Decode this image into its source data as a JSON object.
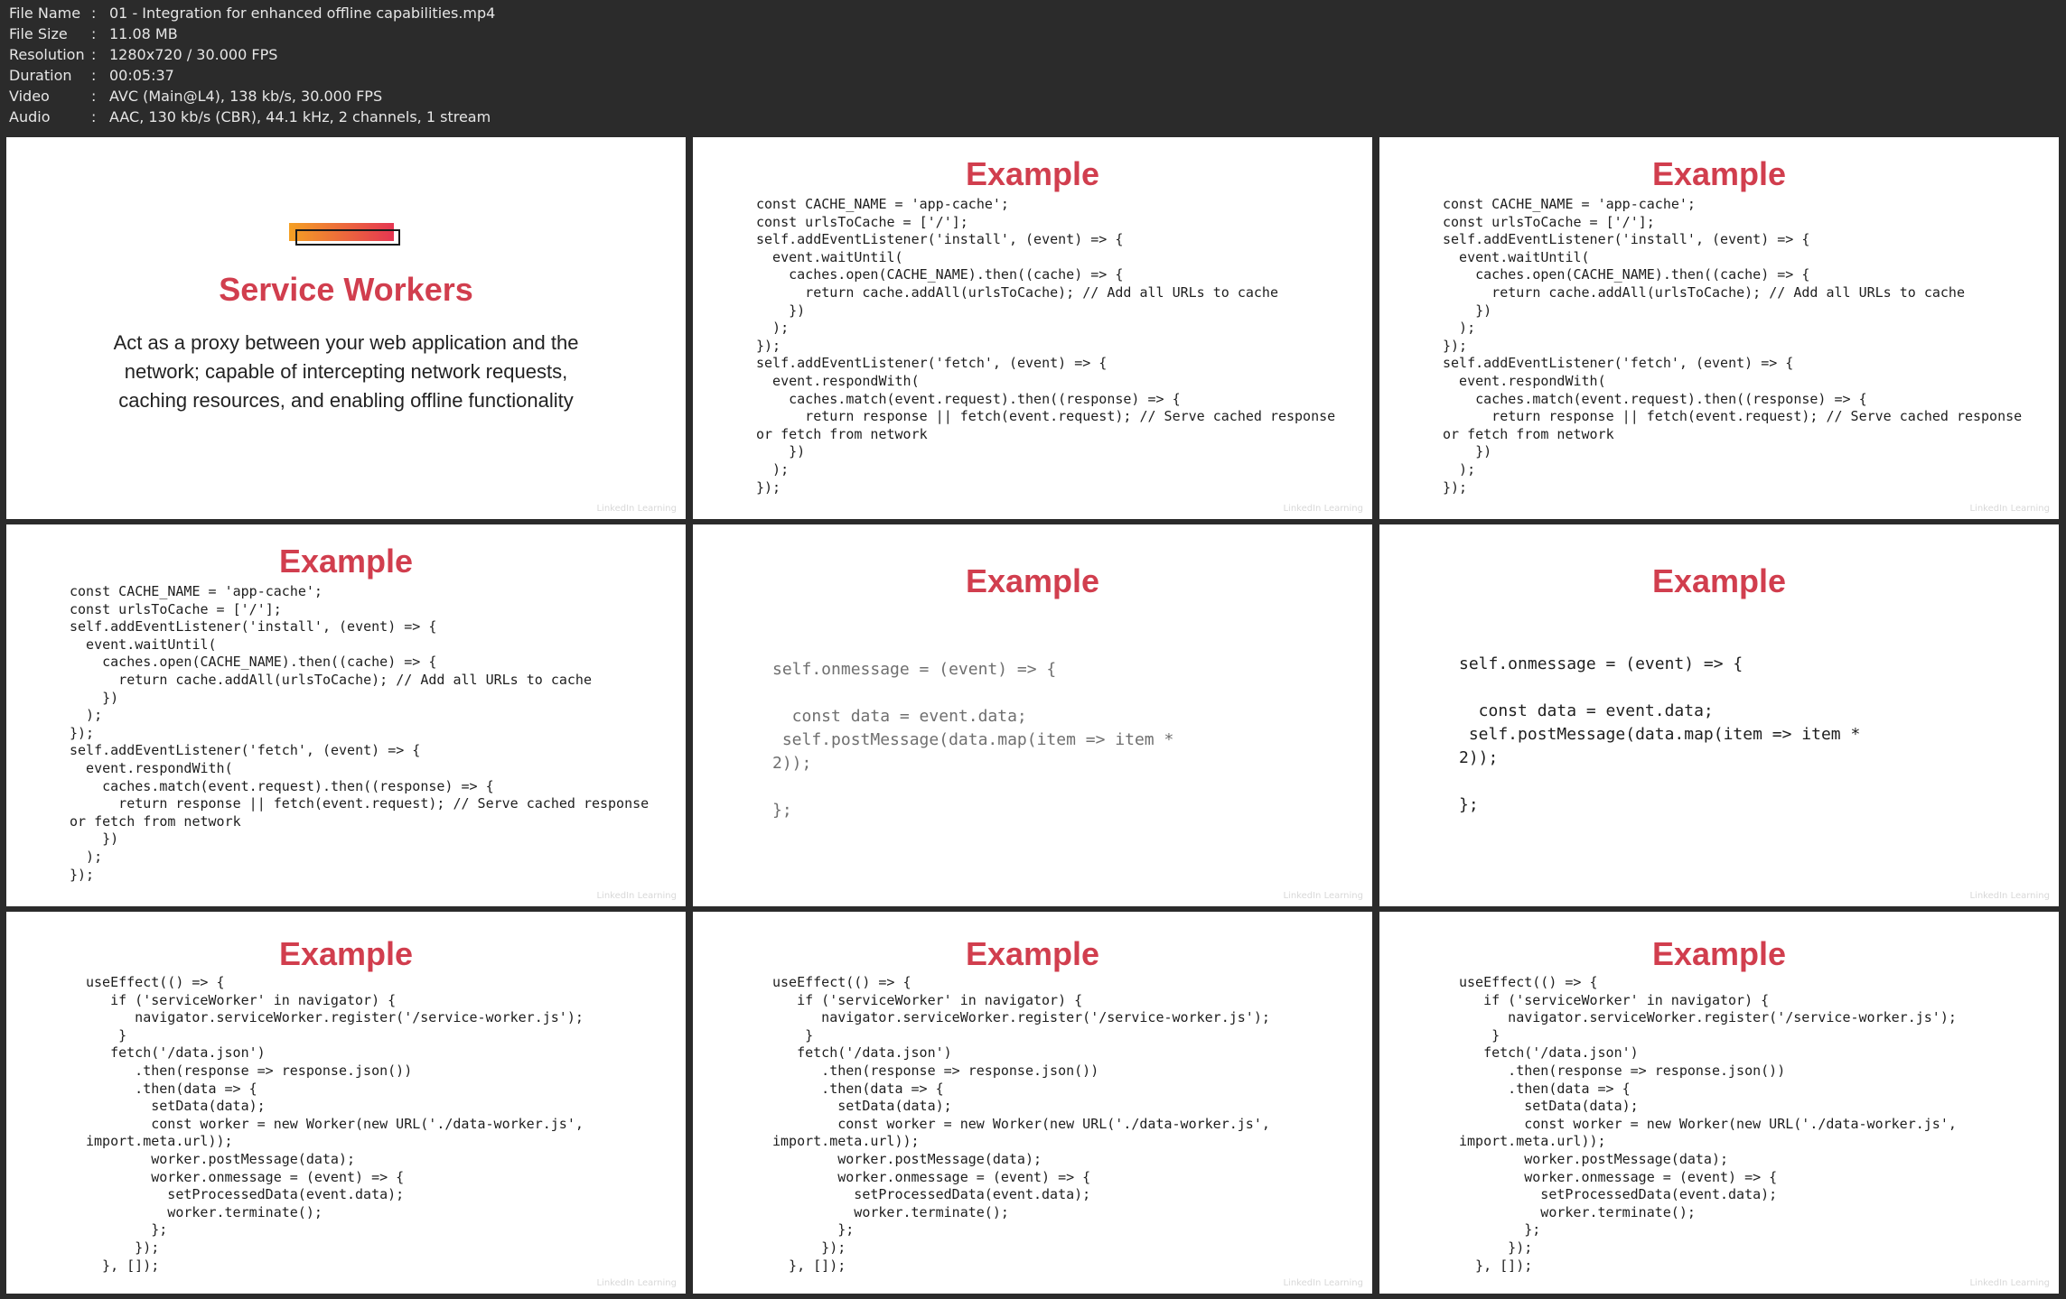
{
  "file_info": [
    {
      "key": "File Name",
      "value": "01 - Integration for enhanced offline capabilities.mp4"
    },
    {
      "key": "File Size",
      "value": "11.08 MB"
    },
    {
      "key": "Resolution",
      "value": "1280x720 / 30.000 FPS"
    },
    {
      "key": "Duration",
      "value": "00:05:37"
    },
    {
      "key": "Video",
      "value": "AVC (Main@L4), 138 kb/s, 30.000 FPS"
    },
    {
      "key": "Audio",
      "value": "AAC, 130 kb/s (CBR), 44.1 kHz, 2 channels, 1 stream"
    }
  ],
  "separator": ":",
  "watermark": "LinkedIn Learning",
  "intro": {
    "title": "Service Workers",
    "description": "Act as a proxy between your web application and the network; capable of intercepting network requests, caching resources, and enabling offline functionality"
  },
  "example_title": "Example",
  "code_sw": "const CACHE_NAME = 'app-cache';\nconst urlsToCache = ['/'];\nself.addEventListener('install', (event) => {\n  event.waitUntil(\n    caches.open(CACHE_NAME).then((cache) => {\n      return cache.addAll(urlsToCache); // Add all URLs to cache\n    })\n  );\n});\nself.addEventListener('fetch', (event) => {\n  event.respondWith(\n    caches.match(event.request).then((response) => {\n      return response || fetch(event.request); // Serve cached response\nor fetch from network\n    })\n  );\n});",
  "code_onmessage": "self.onmessage = (event) => {\n\n  const data = event.data;\n self.postMessage(data.map(item => item *\n2));\n\n};",
  "code_useeffect": "useEffect(() => {\n   if ('serviceWorker' in navigator) {\n      navigator.serviceWorker.register('/service-worker.js');\n    }\n   fetch('/data.json')\n      .then(response => response.json())\n      .then(data => {\n        setData(data);\n        const worker = new Worker(new URL('./data-worker.js',\nimport.meta.url));\n        worker.postMessage(data);\n        worker.onmessage = (event) => {\n          setProcessedData(event.data);\n          worker.terminate();\n        };\n      });\n  }, []);"
}
